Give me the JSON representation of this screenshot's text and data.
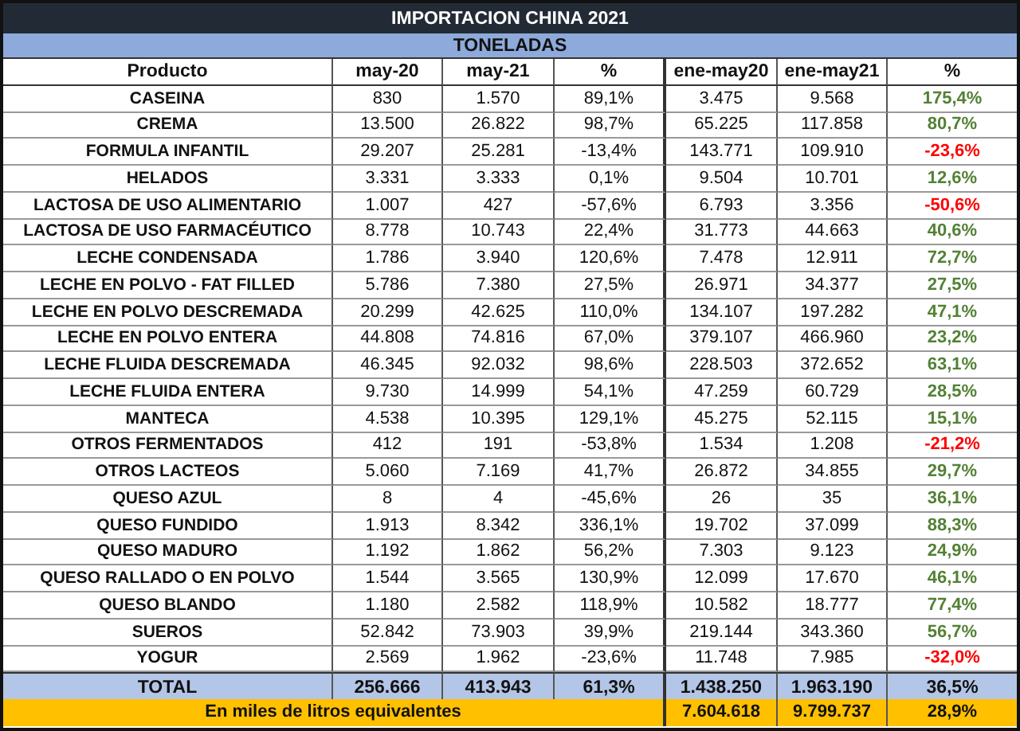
{
  "title": "IMPORTACION CHINA 2021",
  "unit": "TONELADAS",
  "columns": [
    "Producto",
    "may-20",
    "may-21",
    "%",
    "ene-may20",
    "ene-may21",
    "%"
  ],
  "rows": [
    {
      "cells": [
        "CASEINA",
        "830",
        "1.570",
        "89,1%",
        "3.475",
        "9.568",
        "175,4%"
      ],
      "color": "#538135"
    },
    {
      "cells": [
        "CREMA",
        "13.500",
        "26.822",
        "98,7%",
        "65.225",
        "117.858",
        "80,7%"
      ],
      "color": "#538135"
    },
    {
      "cells": [
        "FORMULA INFANTIL",
        "29.207",
        "25.281",
        "-13,4%",
        "143.771",
        "109.910",
        "-23,6%"
      ],
      "color": "#ff0000"
    },
    {
      "cells": [
        "HELADOS",
        "3.331",
        "3.333",
        "0,1%",
        "9.504",
        "10.701",
        "12,6%"
      ],
      "color": "#538135"
    },
    {
      "cells": [
        "LACTOSA DE USO ALIMENTARIO",
        "1.007",
        "427",
        "-57,6%",
        "6.793",
        "3.356",
        "-50,6%"
      ],
      "color": "#ff0000"
    },
    {
      "cells": [
        "LACTOSA DE USO FARMACÉUTICO",
        "8.778",
        "10.743",
        "22,4%",
        "31.773",
        "44.663",
        "40,6%"
      ],
      "color": "#538135"
    },
    {
      "cells": [
        "LECHE CONDENSADA",
        "1.786",
        "3.940",
        "120,6%",
        "7.478",
        "12.911",
        "72,7%"
      ],
      "color": "#538135"
    },
    {
      "cells": [
        "LECHE EN POLVO - FAT FILLED",
        "5.786",
        "7.380",
        "27,5%",
        "26.971",
        "34.377",
        "27,5%"
      ],
      "color": "#538135"
    },
    {
      "cells": [
        "LECHE EN POLVO DESCREMADA",
        "20.299",
        "42.625",
        "110,0%",
        "134.107",
        "197.282",
        "47,1%"
      ],
      "color": "#538135"
    },
    {
      "cells": [
        "LECHE EN POLVO ENTERA",
        "44.808",
        "74.816",
        "67,0%",
        "379.107",
        "466.960",
        "23,2%"
      ],
      "color": "#538135"
    },
    {
      "cells": [
        "LECHE FLUIDA DESCREMADA",
        "46.345",
        "92.032",
        "98,6%",
        "228.503",
        "372.652",
        "63,1%"
      ],
      "color": "#538135"
    },
    {
      "cells": [
        "LECHE FLUIDA ENTERA",
        "9.730",
        "14.999",
        "54,1%",
        "47.259",
        "60.729",
        "28,5%"
      ],
      "color": "#538135"
    },
    {
      "cells": [
        "MANTECA",
        "4.538",
        "10.395",
        "129,1%",
        "45.275",
        "52.115",
        "15,1%"
      ],
      "color": "#538135"
    },
    {
      "cells": [
        "OTROS FERMENTADOS",
        "412",
        "191",
        "-53,8%",
        "1.534",
        "1.208",
        "-21,2%"
      ],
      "color": "#ff0000"
    },
    {
      "cells": [
        "OTROS LACTEOS",
        "5.060",
        "7.169",
        "41,7%",
        "26.872",
        "34.855",
        "29,7%"
      ],
      "color": "#538135"
    },
    {
      "cells": [
        "QUESO AZUL",
        "8",
        "4",
        "-45,6%",
        "26",
        "35",
        "36,1%"
      ],
      "color": "#538135"
    },
    {
      "cells": [
        "QUESO FUNDIDO",
        "1.913",
        "8.342",
        "336,1%",
        "19.702",
        "37.099",
        "88,3%"
      ],
      "color": "#538135"
    },
    {
      "cells": [
        "QUESO MADURO",
        "1.192",
        "1.862",
        "56,2%",
        "7.303",
        "9.123",
        "24,9%"
      ],
      "color": "#538135"
    },
    {
      "cells": [
        "QUESO RALLADO O EN POLVO",
        "1.544",
        "3.565",
        "130,9%",
        "12.099",
        "17.670",
        "46,1%"
      ],
      "color": "#538135"
    },
    {
      "cells": [
        "QUESO BLANDO",
        "1.180",
        "2.582",
        "118,9%",
        "10.582",
        "18.777",
        "77,4%"
      ],
      "color": "#538135"
    },
    {
      "cells": [
        "SUEROS",
        "52.842",
        "73.903",
        "39,9%",
        "219.144",
        "343.360",
        "56,7%"
      ],
      "color": "#538135"
    },
    {
      "cells": [
        "YOGUR",
        "2.569",
        "1.962",
        "-23,6%",
        "11.748",
        "7.985",
        "-32,0%"
      ],
      "color": "#ff0000"
    }
  ],
  "total": [
    "TOTAL",
    "256.666",
    "413.943",
    "61,3%",
    "1.438.250",
    "1.963.190",
    "36,5%"
  ],
  "equivalent": {
    "label": "En miles de litros equivalentes",
    "cells": [
      "7.604.618",
      "9.799.737",
      "28,9%"
    ]
  }
}
